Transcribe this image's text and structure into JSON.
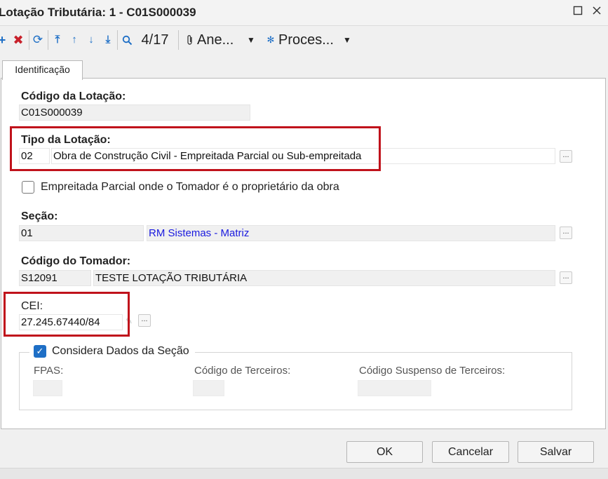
{
  "window": {
    "title": "Lotação Tributária: 1 - C01S000039"
  },
  "toolbar": {
    "record_counter": "4/17",
    "annex_label": "Ane...",
    "process_label": "Proces..."
  },
  "tabs": [
    {
      "label": "Identificação"
    }
  ],
  "form": {
    "codigo_lotacao": {
      "label": "Código da Lotação:",
      "value": "C01S000039"
    },
    "tipo_lotacao": {
      "label": "Tipo da Lotação:",
      "code": "02",
      "description": "Obra de Construção Civil - Empreitada Parcial ou Sub-empreitada"
    },
    "empreitada": {
      "label": "Empreitada Parcial onde o Tomador é o proprietário da obra",
      "checked": false
    },
    "secao": {
      "label": "Seção:",
      "code": "01",
      "description": "RM Sistemas - Matriz"
    },
    "tomador": {
      "label": "Código do Tomador:",
      "code": "S12091",
      "description": "TESTE LOTAÇÃO TRIBUTÁRIA"
    },
    "cei": {
      "label": "CEI:",
      "value": "27.245.67440/84"
    },
    "considera": {
      "label": "Considera Dados da Seção",
      "checked": true,
      "fpas_label": "FPAS:",
      "terceiros_label": "Código de Terceiros:",
      "suspenso_label": "Código Suspenso de Terceiros:"
    }
  },
  "buttons": {
    "ok": "OK",
    "cancel": "Cancelar",
    "save": "Salvar"
  },
  "colors": {
    "highlight": "#c0121b",
    "link": "#1a1adf",
    "check": "#1e6fc6"
  }
}
